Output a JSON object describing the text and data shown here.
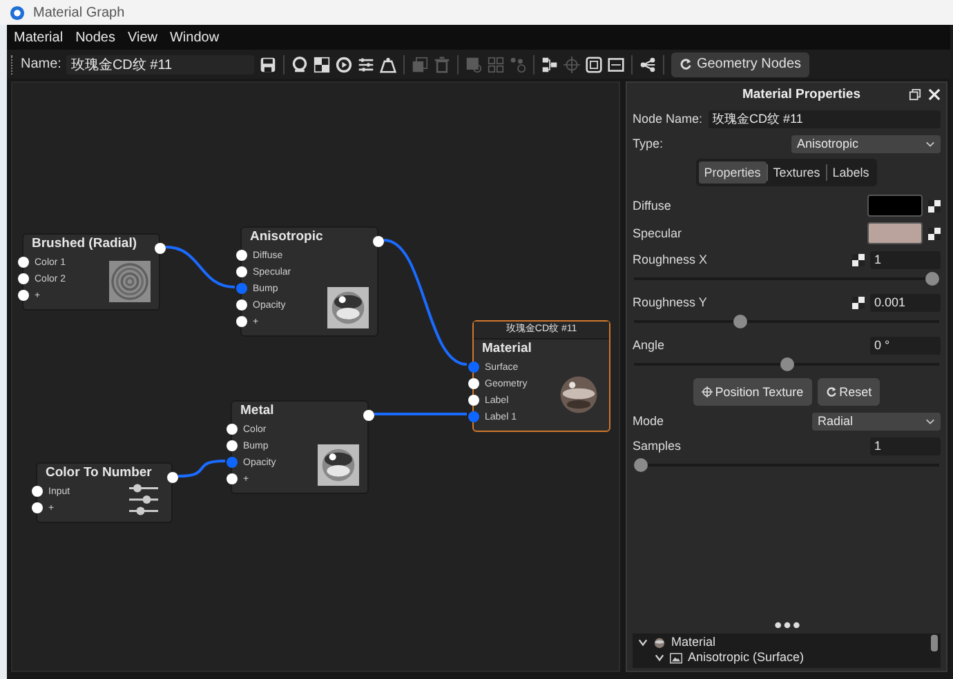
{
  "window": {
    "title": "Material Graph"
  },
  "menu": [
    "Material",
    "Nodes",
    "View",
    "Window"
  ],
  "toolbar": {
    "name_label": "Name:",
    "name_value": "玫瑰金CD纹 #11",
    "tools": [
      {
        "kind": "save",
        "disabled": false
      },
      {
        "kind": "sphere",
        "disabled": false
      },
      {
        "kind": "checker",
        "disabled": false
      },
      {
        "kind": "play",
        "disabled": false
      },
      {
        "kind": "sliders",
        "disabled": false
      },
      {
        "kind": "weight",
        "disabled": false
      },
      {
        "kind": "copy",
        "disabled": true
      },
      {
        "kind": "trash",
        "disabled": true
      },
      {
        "kind": "layers",
        "disabled": true
      },
      {
        "kind": "grid",
        "disabled": true
      },
      {
        "kind": "dots",
        "disabled": true
      },
      {
        "kind": "hierarchy",
        "disabled": false
      },
      {
        "kind": "target",
        "disabled": true
      },
      {
        "kind": "frame",
        "disabled": false
      },
      {
        "kind": "badge",
        "disabled": false
      },
      {
        "kind": "share",
        "disabled": false
      }
    ],
    "button": "Geometry Nodes"
  },
  "nodes": [
    {
      "title": "Brushed (Radial)",
      "kind": "rings",
      "ports": [
        {
          "label": "Color 1",
          "connected": false
        },
        {
          "label": "Color 2",
          "connected": false
        },
        {
          "label": "+",
          "connected": false
        }
      ]
    },
    {
      "title": "Anisotropic",
      "kind": "chrome",
      "ports": [
        {
          "label": "Diffuse",
          "connected": false
        },
        {
          "label": "Specular",
          "connected": false
        },
        {
          "label": "Bump",
          "connected": true
        },
        {
          "label": "Opacity",
          "connected": false
        },
        {
          "label": "+",
          "connected": false
        }
      ]
    },
    {
      "title": "Material",
      "caption": "玫瑰金CD纹 #11",
      "selected": true,
      "kind": "sphere",
      "ports": [
        {
          "label": "Surface",
          "connected": true
        },
        {
          "label": "Geometry",
          "connected": false
        },
        {
          "label": "Label",
          "connected": false
        },
        {
          "label": "Label 1",
          "connected": true
        }
      ]
    },
    {
      "title": "Metal",
      "kind": "chrome",
      "ports": [
        {
          "label": "Color",
          "connected": false
        },
        {
          "label": "Bump",
          "connected": false
        },
        {
          "label": "Opacity",
          "connected": true
        },
        {
          "label": "+",
          "connected": false
        }
      ]
    },
    {
      "title": "Color To Number",
      "kind": "sliders",
      "ports": [
        {
          "label": "Input",
          "connected": false
        },
        {
          "label": "+",
          "connected": false
        }
      ]
    }
  ],
  "panel": {
    "title": "Material Properties",
    "node_name_label": "Node Name:",
    "node_name": "玫瑰金CD纹 #11",
    "type_label": "Type:",
    "type_value": "Anisotropic",
    "tabs": [
      {
        "label": "Properties",
        "selected": true
      },
      {
        "label": "Textures",
        "selected": false
      },
      {
        "label": "Labels",
        "selected": false
      }
    ],
    "properties": [
      {
        "kind": "color",
        "label": "Diffuse",
        "color": "#000000",
        "texture": true
      },
      {
        "kind": "color",
        "label": "Specular",
        "color": "#b9a39c",
        "texture": true
      },
      {
        "kind": "slider",
        "label": "Roughness X",
        "value": "1",
        "level": 1,
        "texture": true
      },
      {
        "kind": "slider",
        "label": "Roughness Y",
        "value": "0.001",
        "level": 0.34,
        "texture": true
      },
      {
        "kind": "slider",
        "label": "Angle",
        "value": "0 °",
        "level": 0.5,
        "texture": false
      },
      {
        "kind": "buttons",
        "buttons": [
          {
            "label": "Position Texture"
          },
          {
            "label": "Reset"
          }
        ]
      },
      {
        "kind": "select",
        "label": "Mode",
        "value": "Radial"
      },
      {
        "kind": "slider",
        "label": "Samples",
        "value": "1",
        "level": 0,
        "texture": false
      }
    ],
    "tree": [
      {
        "label": "Material",
        "expanded": true,
        "children": [
          {
            "label": "Anisotropic (Surface)",
            "expanded": true
          }
        ]
      }
    ]
  }
}
